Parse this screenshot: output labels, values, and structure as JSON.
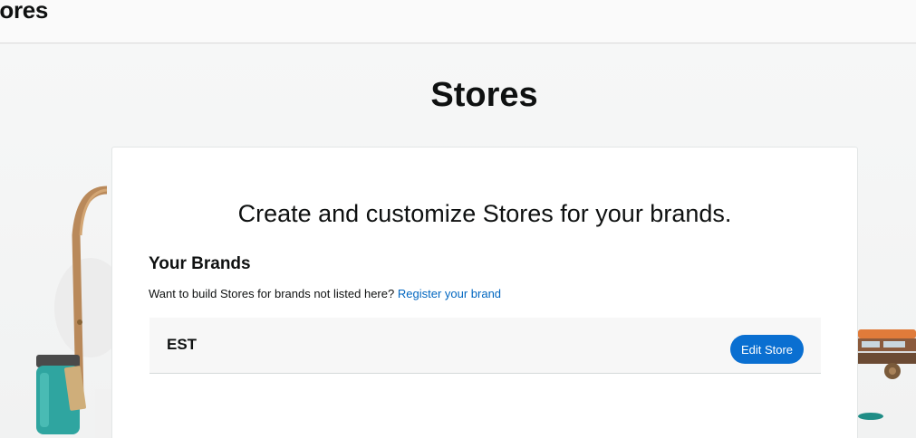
{
  "header": {
    "title": "tores"
  },
  "main": {
    "title": "Stores",
    "card": {
      "heading": "Create and customize Stores for your brands.",
      "brands_heading": "Your Brands",
      "note_text": "Want to build Stores for brands not listed here?",
      "register_link": "Register your brand",
      "brands": [
        {
          "name": "EST",
          "action_label": "Edit Store"
        }
      ]
    }
  },
  "colors": {
    "accent_button": "#0a6fd1",
    "link": "#0066c0",
    "text": "#0f1111"
  }
}
